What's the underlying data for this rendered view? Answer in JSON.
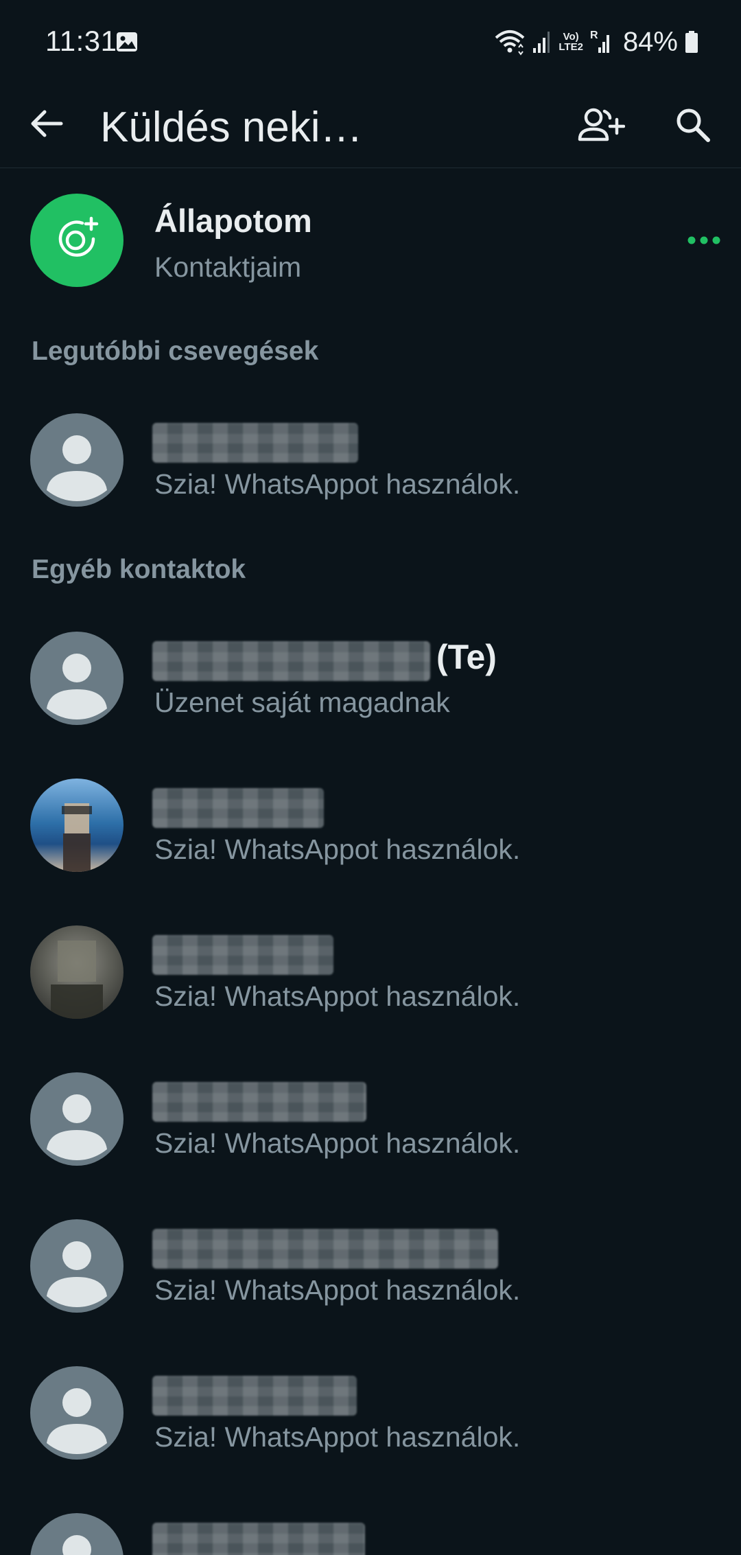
{
  "status_bar": {
    "time": "11:31",
    "network_label_1": "Vo)",
    "network_label_2": "LTE2",
    "roaming_label": "R",
    "battery": "84%"
  },
  "app_bar": {
    "title": "Küldés neki…",
    "icons": [
      "back-arrow-icon",
      "add-contact-icon",
      "search-icon"
    ]
  },
  "status_item": {
    "title": "Állapotom",
    "subtitle": "Kontaktjaim",
    "accent_color": "#21c063"
  },
  "sections": {
    "recent": "Legutóbbi csevegések",
    "other": "Egyéb kontaktok"
  },
  "contacts": [
    {
      "subtitle": "Szia! WhatsAppot használok."
    },
    {
      "suffix": "(Te)",
      "subtitle": "Üzenet saját magadnak"
    },
    {
      "subtitle": "Szia! WhatsAppot használok."
    },
    {
      "subtitle": "Szia! WhatsAppot használok."
    },
    {
      "subtitle": "Szia! WhatsAppot használok."
    },
    {
      "subtitle": "Szia! WhatsAppot használok."
    },
    {
      "subtitle": "Szia! WhatsAppot használok."
    },
    {
      "subtitle": ""
    }
  ],
  "colors": {
    "background": "#0b141a",
    "primary_text": "#e9edef",
    "secondary_text": "#8696a0",
    "accent": "#21c063",
    "default_avatar": "#6a7b85"
  }
}
